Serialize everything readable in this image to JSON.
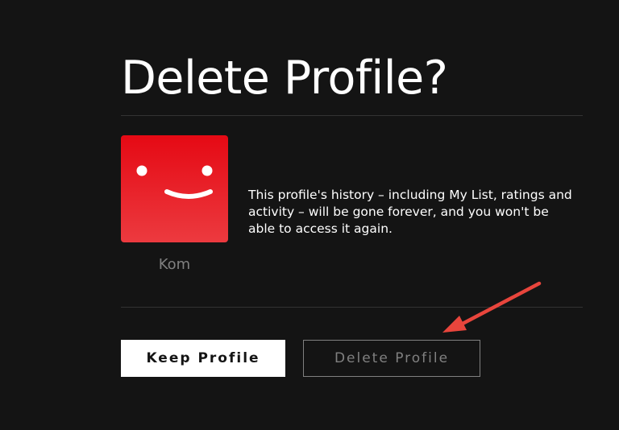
{
  "page": {
    "title": "Delete Profile?"
  },
  "profile": {
    "name": "Kom",
    "avatar_icon": "smiley-face-icon",
    "avatar_color": "#e50914"
  },
  "warning": {
    "text": "This profile's history – including My List, ratings and activity – will be gone forever, and you won't be able to access it again."
  },
  "actions": {
    "keep_label": "Keep Profile",
    "delete_label": "Delete Profile"
  },
  "annotation": {
    "icon": "red-arrow-icon",
    "color": "#e8453c"
  }
}
